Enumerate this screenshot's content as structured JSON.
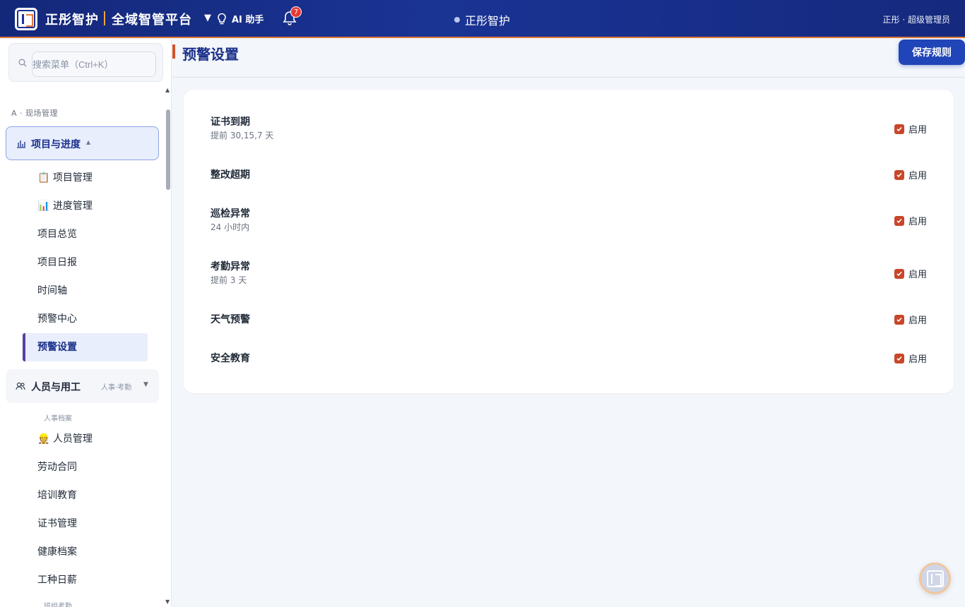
{
  "header": {
    "brand": "正彤智护",
    "platform": "全域智管平台",
    "ai_label": "AI 助手",
    "notification_count": "7",
    "center_title": "正彤智护",
    "user": "正彤 · 超级管理员"
  },
  "sidebar": {
    "search_placeholder": "搜索菜单（Ctrl+K）",
    "section_label": "A · 现场管理",
    "group1": {
      "label": "项目与进度",
      "items": [
        {
          "icon": "📋",
          "label": "项目管理"
        },
        {
          "icon": "📊",
          "label": "进度管理"
        },
        {
          "label": "项目总览"
        },
        {
          "label": "项目日报"
        },
        {
          "label": "时间轴"
        },
        {
          "label": "预警中心"
        },
        {
          "label": "预警设置"
        }
      ]
    },
    "group2": {
      "label": "人员与用工",
      "sub": "人事·考勤",
      "sub_label_1": "人事档案",
      "items": [
        {
          "icon": "👷",
          "label": "人员管理"
        },
        {
          "label": "劳动合同"
        },
        {
          "label": "培训教育"
        },
        {
          "label": "证书管理"
        },
        {
          "label": "健康档案"
        },
        {
          "label": "工种日薪"
        }
      ],
      "sub_label_2": "班组考勤"
    }
  },
  "main": {
    "title": "预警设置",
    "save_label": "保存规则",
    "toggle_label": "启用",
    "rules": [
      {
        "name": "证书到期",
        "desc": "提前 30,15,7 天",
        "enabled": true
      },
      {
        "name": "整改超期",
        "desc": "",
        "enabled": true
      },
      {
        "name": "巡检异常",
        "desc": "24 小时内",
        "enabled": true
      },
      {
        "name": "考勤异常",
        "desc": "提前 3 天",
        "enabled": true
      },
      {
        "name": "天气预警",
        "desc": "",
        "enabled": true
      },
      {
        "name": "安全教育",
        "desc": "",
        "enabled": true
      }
    ]
  },
  "colors": {
    "header_bg": "#1a3494",
    "accent": "#1f45b8",
    "checkbox": "#c8462a",
    "title": "#1a2f8a"
  }
}
